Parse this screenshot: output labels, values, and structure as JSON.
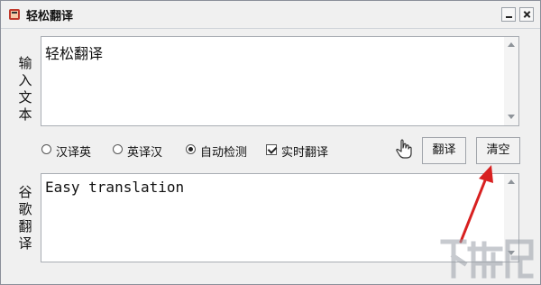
{
  "window": {
    "title": "轻松翻译"
  },
  "input": {
    "label": "输入文本",
    "label_chars": [
      "输",
      "入",
      "文",
      "本"
    ],
    "value": "轻松翻译"
  },
  "options": {
    "radio_zh_en": "汉译英",
    "radio_en_zh": "英译汉",
    "radio_auto": "自动检测",
    "selected": "自动检测",
    "realtime": "实时翻译",
    "realtime_checked": true
  },
  "buttons": {
    "translate": "翻译",
    "clear": "清空"
  },
  "output": {
    "label": "谷歌翻译",
    "label_chars": [
      "谷",
      "歌",
      "翻",
      "译"
    ],
    "value": "Easy translation"
  },
  "colors": {
    "annotation_arrow": "#d82020",
    "window_bg": "#f0f0f0"
  },
  "watermark": {
    "text": "下载吧"
  }
}
